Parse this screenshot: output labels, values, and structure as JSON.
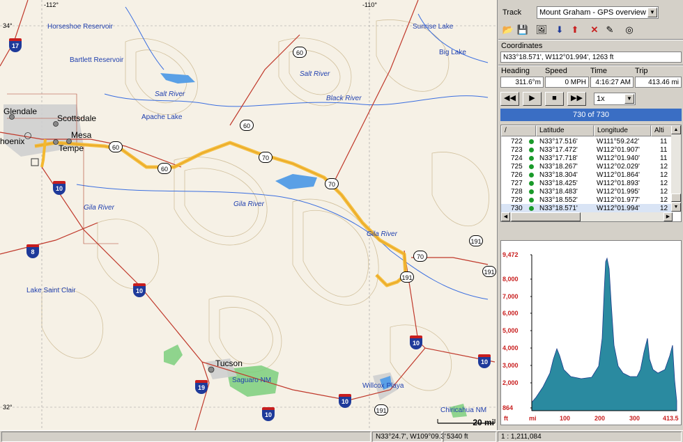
{
  "map": {
    "coord_labels": [
      "-112°",
      "-110°",
      "34°",
      "32°"
    ],
    "cities": [
      "Glendale",
      "Scottsdale",
      "Mesa",
      "Tempe",
      "hoenix",
      "Tucson"
    ],
    "water_labels": [
      "Salt River",
      "Salt River",
      "Black River",
      "Gila River",
      "Gila River",
      "Gila River"
    ],
    "lake_labels": [
      "Horseshoe Reservoir",
      "Bartlett Reservoir",
      "Apache Lake",
      "Sunrise Lake",
      "Big Lake",
      "Lake Saint Clair",
      "Willcox Playa",
      "Saguaro NM",
      "Chiricahua NM"
    ],
    "us_shields": [
      "60",
      "60",
      "60",
      "60",
      "70",
      "70",
      "70",
      "191",
      "191",
      "191",
      "191"
    ],
    "interstates": [
      "17",
      "10",
      "8",
      "10",
      "19",
      "10",
      "10",
      "10"
    ],
    "scale": "20 mi"
  },
  "panel": {
    "track_label": "Track",
    "track_value": "Mount Graham - GPS overview m",
    "coords_label": "Coordinates",
    "coords_value": "N33°18.571',  W112°01.994',  1263 ft",
    "heading_label": "Heading",
    "heading_value": "311.6°m",
    "speed_label": "Speed",
    "speed_value": "0 MPH",
    "time_label": "Time",
    "time_value": "4:16:27 AM",
    "trip_label": "Trip",
    "trip_value": "413.46 mi",
    "speed_select": "1x",
    "progress_text": "730 of 730",
    "progress_fraction": 1.0,
    "table": {
      "columns": [
        "/",
        "Latitude",
        "Longitude",
        "Alti"
      ],
      "rows": [
        [
          "722",
          "N33°17.516'",
          "W111°59.242'",
          "11"
        ],
        [
          "723",
          "N33°17.472'",
          "W112°01.907'",
          "11"
        ],
        [
          "724",
          "N33°17.718'",
          "W112°01.940'",
          "11"
        ],
        [
          "725",
          "N33°18.267'",
          "W112°02.029'",
          "12"
        ],
        [
          "726",
          "N33°18.304'",
          "W112°01.864'",
          "12"
        ],
        [
          "727",
          "N33°18.425'",
          "W112°01.893'",
          "12"
        ],
        [
          "728",
          "N33°18.483'",
          "W112°01.995'",
          "12"
        ],
        [
          "729",
          "N33°18.552'",
          "W112°01.977'",
          "12"
        ],
        [
          "730",
          "N33°18.571'",
          "W112°01.994'",
          "12"
        ]
      ]
    },
    "profile": {
      "y_ticks": [
        "9,472",
        "8,000",
        "7,000",
        "6,000",
        "5,000",
        "4,000",
        "3,000",
        "2,000",
        "864"
      ],
      "y_unit": "ft",
      "x_ticks": [
        "100",
        "200",
        "300",
        "413.5"
      ],
      "x_unit": "mi"
    }
  },
  "status": {
    "coords": "N33°24.7', W109°09.3'",
    "elevation": "5340 ft",
    "scale": "1 : 1,211,084"
  },
  "colors": {
    "track": "#f4b82e",
    "highlight": "#3a6ec4",
    "water": "#1f3fae",
    "road": "#c0392b"
  }
}
